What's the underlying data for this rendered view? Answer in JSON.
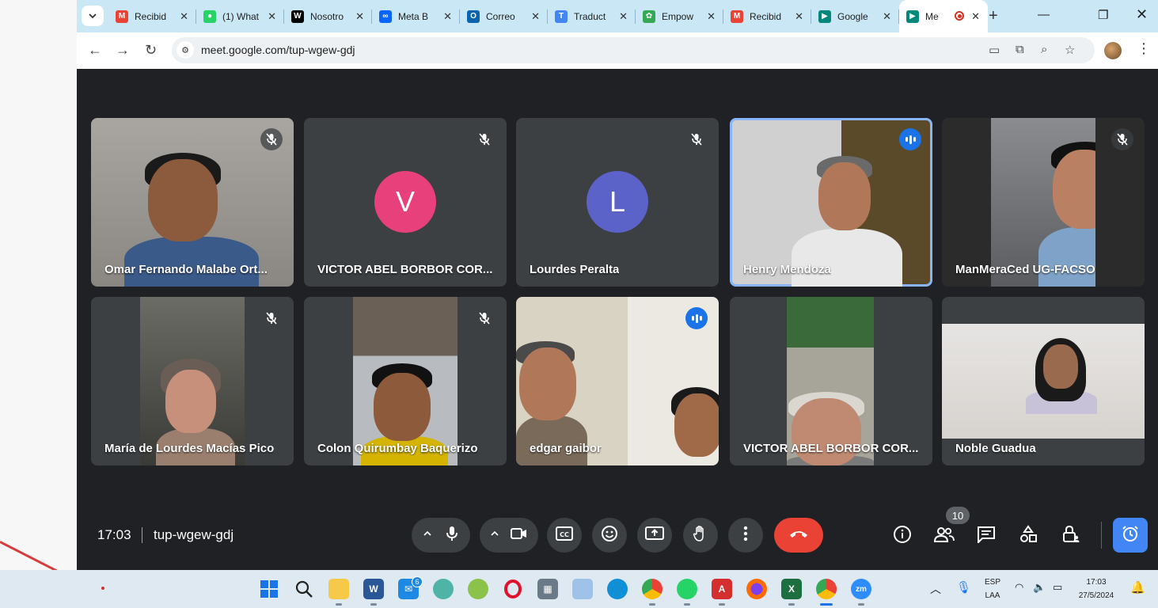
{
  "browser": {
    "tabs": [
      {
        "title": "Recibid",
        "icon": "gmail-icon",
        "color": "#ea4335"
      },
      {
        "title": "(1) What",
        "icon": "whatsapp-icon",
        "color": "#25d366"
      },
      {
        "title": "Nosotro",
        "icon": "wix-icon",
        "color": "#000000"
      },
      {
        "title": "Meta B",
        "icon": "meta-icon",
        "color": "#0866ff"
      },
      {
        "title": "Correo",
        "icon": "outlook-icon",
        "color": "#0a64ad"
      },
      {
        "title": "Traduct",
        "icon": "translate-icon",
        "color": "#4285f4"
      },
      {
        "title": "Empow",
        "icon": "gear-icon",
        "color": "#34a853"
      },
      {
        "title": "Recibid",
        "icon": "gmail-icon",
        "color": "#ea4335"
      },
      {
        "title": "Google",
        "icon": "google-meet-icon",
        "color": "#00897b"
      },
      {
        "title": "Me",
        "icon": "google-meet-icon",
        "color": "#00897b"
      }
    ],
    "url": "meet.google.com/tup-wgew-gdj"
  },
  "meet": {
    "participants": [
      {
        "name": "Omar Fernando Malabe Ort...",
        "muted": true,
        "type": "video"
      },
      {
        "name": "VICTOR ABEL BORBOR COR...",
        "muted": true,
        "type": "avatar",
        "initial": "V",
        "color": "#e8407a"
      },
      {
        "name": "Lourdes Peralta",
        "muted": true,
        "type": "avatar",
        "initial": "L",
        "color": "#5b63c8"
      },
      {
        "name": "Henry Mendoza",
        "muted": false,
        "speaking": true,
        "type": "video"
      },
      {
        "name": "ManMeraCed UG-FACSO",
        "muted": true,
        "type": "video"
      },
      {
        "name": "María de Lourdes Macías Pico",
        "muted": true,
        "type": "video"
      },
      {
        "name": "Colon Quirumbay Baquerizo",
        "muted": true,
        "type": "video"
      },
      {
        "name": "edgar gaibor",
        "muted": false,
        "speaking": true,
        "type": "video"
      },
      {
        "name": "VICTOR ABEL BORBOR COR...",
        "muted": false,
        "type": "video"
      },
      {
        "name": "Noble Guadua",
        "muted": false,
        "type": "video"
      }
    ],
    "time": "17:03",
    "meeting_code": "tup-wgew-gdj",
    "people_count": "10"
  },
  "taskbar": {
    "language": "ESP",
    "layout": "LAA",
    "time": "17:03",
    "date": "27/5/2024",
    "mail_badge": "6"
  }
}
